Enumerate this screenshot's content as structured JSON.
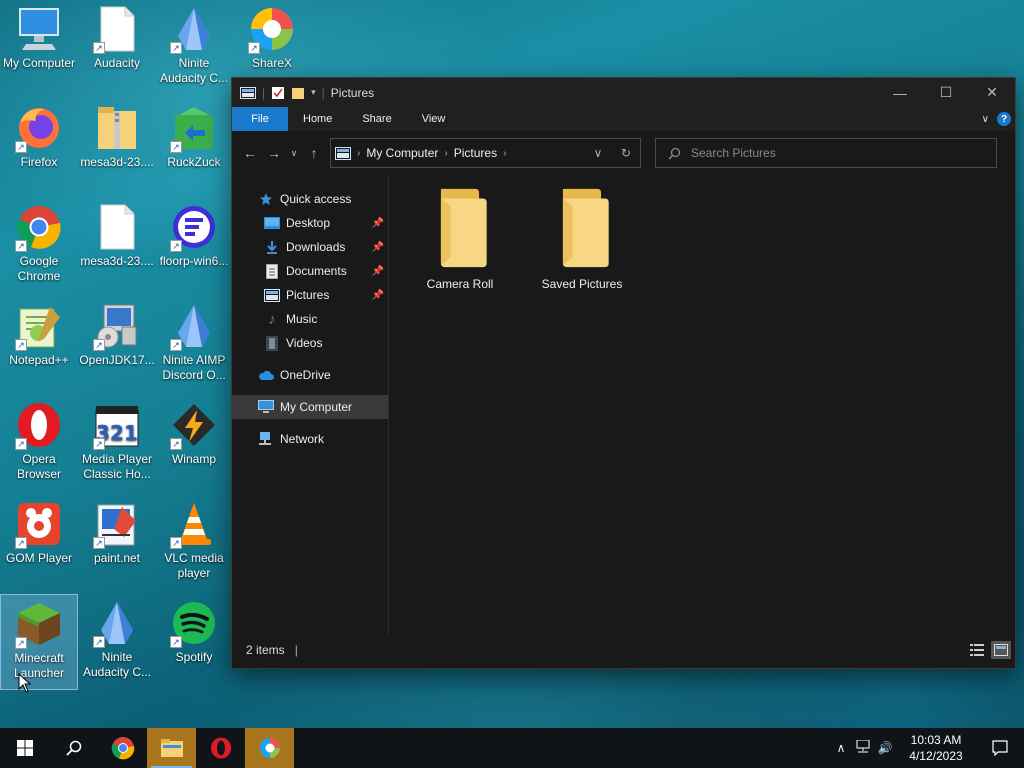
{
  "desktop": {
    "icons": [
      {
        "label": "My Computer",
        "icon": "computer-icon"
      },
      {
        "label": "Audacity",
        "icon": "file-shortcut-icon"
      },
      {
        "label": "Ninite Audacity C...",
        "icon": "ninite-icon"
      },
      {
        "label": "ShareX",
        "icon": "sharex-icon"
      },
      {
        "label": "Firefox",
        "icon": "firefox-icon"
      },
      {
        "label": "mesa3d-23....",
        "icon": "zip-folder-icon"
      },
      {
        "label": "RuckZuck",
        "icon": "ruckzuck-icon"
      },
      {
        "label": "Google Chrome",
        "icon": "chrome-icon"
      },
      {
        "label": "mesa3d-23....",
        "icon": "file-icon"
      },
      {
        "label": "floorp-win6...",
        "icon": "floorp-icon"
      },
      {
        "label": "Notepad++",
        "icon": "notepadpp-icon"
      },
      {
        "label": "OpenJDK17...",
        "icon": "installer-icon"
      },
      {
        "label": "Ninite AIMP Discord O...",
        "icon": "ninite-icon"
      },
      {
        "label": "Opera Browser",
        "icon": "opera-icon"
      },
      {
        "label": "Media Player Classic Ho...",
        "icon": "mpc-icon"
      },
      {
        "label": "Winamp",
        "icon": "winamp-icon"
      },
      {
        "label": "GOM Player",
        "icon": "gom-icon"
      },
      {
        "label": "paint.net",
        "icon": "paintnet-icon"
      },
      {
        "label": "VLC media player",
        "icon": "vlc-icon"
      },
      {
        "label": "Minecraft Launcher",
        "icon": "minecraft-icon"
      },
      {
        "label": "Ninite Audacity C...",
        "icon": "ninite-icon"
      },
      {
        "label": "Spotify",
        "icon": "spotify-icon"
      }
    ]
  },
  "explorer": {
    "title": "Pictures",
    "ribbon": {
      "file": "File",
      "home": "Home",
      "share": "Share",
      "view": "View"
    },
    "address": {
      "crumbs": [
        "My Computer",
        "Pictures"
      ]
    },
    "search": {
      "placeholder": "Search Pictures"
    },
    "nav": {
      "quick_access": "Quick access",
      "desktop": "Desktop",
      "downloads": "Downloads",
      "documents": "Documents",
      "pictures": "Pictures",
      "music": "Music",
      "videos": "Videos",
      "onedrive": "OneDrive",
      "my_computer": "My Computer",
      "network": "Network"
    },
    "items": [
      {
        "name": "Camera Roll"
      },
      {
        "name": "Saved Pictures"
      }
    ],
    "status": {
      "count": "2 items"
    }
  },
  "taskbar": {
    "time": "10:03 AM",
    "date": "4/12/2023"
  },
  "colors": {
    "accent": "#1979ca",
    "folder": "#f5d27a",
    "window_bg": "#191919"
  }
}
